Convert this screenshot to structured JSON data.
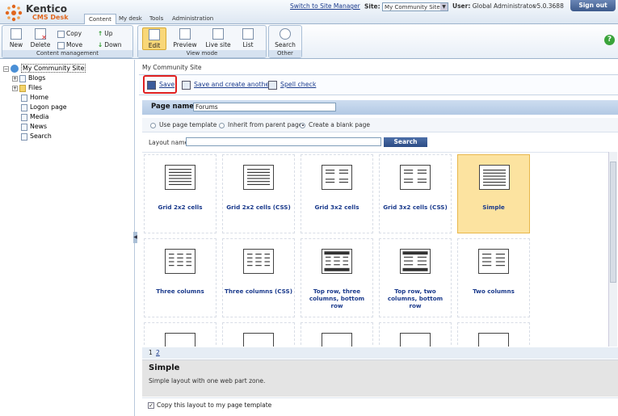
{
  "app": {
    "logo_title": "Kentico",
    "logo_subtitle": "CMS Desk",
    "tabs": [
      {
        "label": "Content",
        "active": true
      },
      {
        "label": "My desk",
        "active": false
      },
      {
        "label": "Tools",
        "active": false
      },
      {
        "label": "Administration",
        "active": false
      }
    ],
    "switch_link": "Switch to Site Manager",
    "site_label": "Site:",
    "site_value": "My Community Site",
    "user_label": "User:",
    "user_value": "Global Administrator",
    "version": "v5.0.3688",
    "signout": "Sign out"
  },
  "ribbon": {
    "content_management": {
      "label": "Content management",
      "new": "New",
      "delete": "Delete",
      "copy": "Copy",
      "move": "Move",
      "up": "Up",
      "down": "Down"
    },
    "view_mode": {
      "label": "View mode",
      "edit": "Edit",
      "preview": "Preview",
      "live_site": "Live site",
      "list": "List",
      "active": "Edit"
    },
    "other": {
      "label": "Other",
      "search": "Search"
    }
  },
  "tree": {
    "root": "My Community Site",
    "items": [
      "Blogs",
      "Files",
      "Home",
      "Logon page",
      "Media",
      "News",
      "Search"
    ]
  },
  "main": {
    "breadcrumb": "My Community Site",
    "actions": {
      "save": "Save",
      "save_create": "Save and create another",
      "spell": "Spell check"
    },
    "page_name_label": "Page name:",
    "page_name_value": "Forums",
    "radios": [
      {
        "label": "Use page template",
        "checked": false
      },
      {
        "label": "Inherit from parent page",
        "checked": false
      },
      {
        "label": "Create a blank page",
        "checked": true
      }
    ],
    "layout_name_label": "Layout name:",
    "layout_name_value": "",
    "search_button": "Search",
    "layouts": [
      {
        "name": "Grid 2x2 cells",
        "selected": false
      },
      {
        "name": "Grid 2x2 cells (CSS)",
        "selected": false
      },
      {
        "name": "Grid 3x2 cells",
        "selected": false
      },
      {
        "name": "Grid 3x2 cells (CSS)",
        "selected": false
      },
      {
        "name": "Simple",
        "selected": true
      },
      {
        "name": "Three columns",
        "selected": false
      },
      {
        "name": "Three columns (CSS)",
        "selected": false
      },
      {
        "name": "Top row, three columns, bottom row",
        "selected": false
      },
      {
        "name": "Top row, two columns, bottom row",
        "selected": false
      },
      {
        "name": "Two columns",
        "selected": false
      }
    ],
    "pager": [
      "1",
      "2"
    ],
    "selected_title": "Simple",
    "selected_desc": "Simple layout with one web part zone.",
    "copy_layout_label": "Copy this layout to my page template",
    "copy_layout_checked": true
  },
  "colors": {
    "accent": "#1a3a8c",
    "selected_bg": "#fce3a0",
    "save_highlight": "#e02020"
  }
}
